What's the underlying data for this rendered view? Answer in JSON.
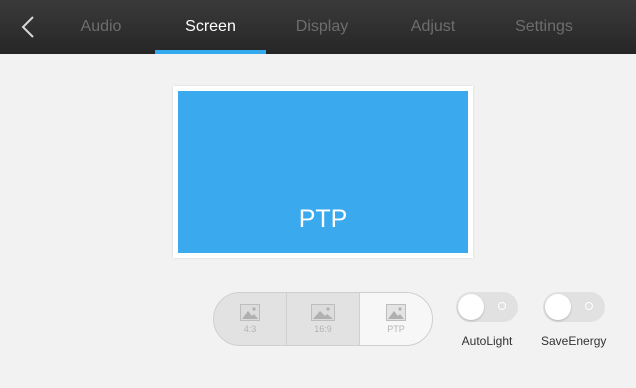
{
  "nav": {
    "back_icon": "chevron-left-icon",
    "tabs": [
      {
        "label": "Audio",
        "active": false
      },
      {
        "label": "Screen",
        "active": true
      },
      {
        "label": "Display",
        "active": false
      },
      {
        "label": "Adjust",
        "active": false
      },
      {
        "label": "Settings",
        "active": false
      }
    ]
  },
  "preview": {
    "label": "PTP",
    "color": "#3aa9ee"
  },
  "aspect_ratio": {
    "options": [
      {
        "label": "4:3",
        "icon": "image-icon"
      },
      {
        "label": "16:9",
        "icon": "image-icon"
      },
      {
        "label": "PTP",
        "icon": "image-icon"
      }
    ],
    "selected": "PTP"
  },
  "toggles": [
    {
      "label": "AutoLight",
      "state": "off"
    },
    {
      "label": "SaveEnergy",
      "state": "off"
    }
  ],
  "colors": {
    "accent": "#35a9ee",
    "topbar": "#2e2e2e",
    "background": "#f2f2f2"
  }
}
